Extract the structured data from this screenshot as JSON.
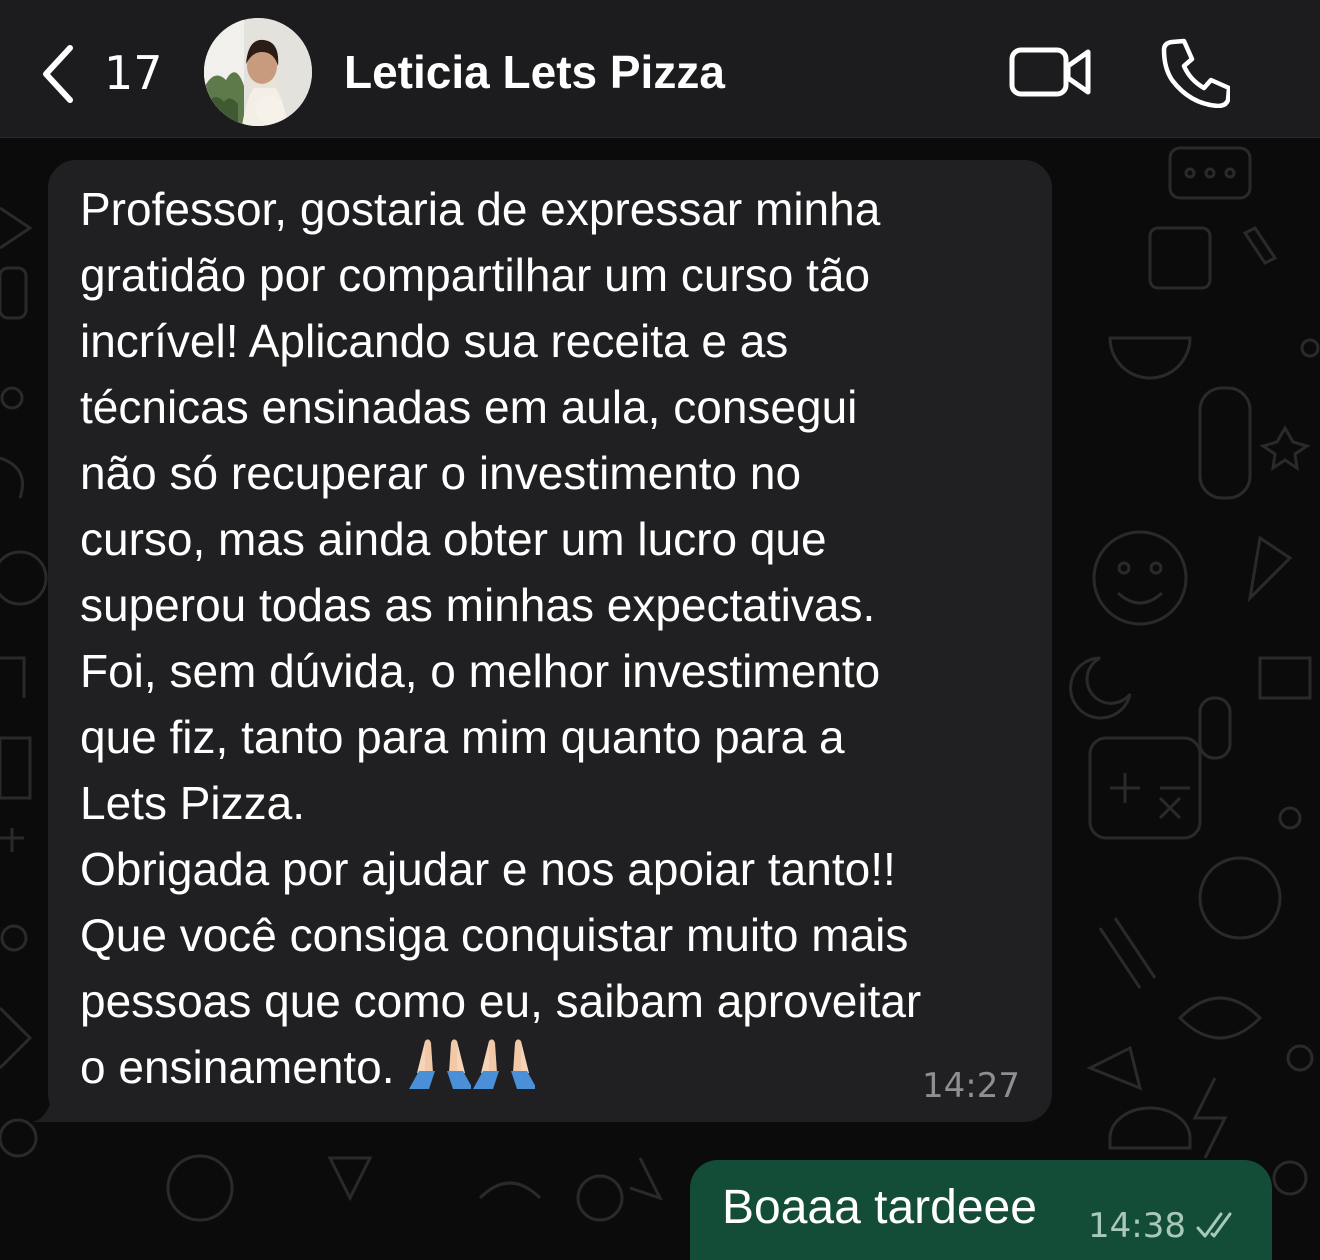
{
  "header": {
    "back_count": "17",
    "contact_name": "Leticia Lets Pizza",
    "back_icon": "chevron-left-icon",
    "video_icon": "video-camera-icon",
    "call_icon": "phone-icon"
  },
  "messages": [
    {
      "direction": "incoming",
      "text": "Professor, gostaria de expressar minha\ngratidão por compartilhar um curso tão\nincrível! Aplicando sua receita e as\ntécnicas ensinadas em aula, consegui\nnão só recuperar o investimento no\ncurso, mas ainda obter um lucro que\nsuperou todas as minhas expectativas.\nFoi, sem dúvida, o melhor investimento\nque fiz, tanto para mim quanto para a\nLets Pizza.\nObrigada por ajudar e nos apoiar tanto!!\nQue você consiga conquistar muito mais\npessoas que como eu, saibam aproveitar\no ensinamento.",
      "emoji": "🙏🏻🙏🏻",
      "time": "14:27"
    },
    {
      "direction": "outgoing",
      "text": "Boaaa tardeee",
      "time": "14:38",
      "status_icon": "double-check-icon"
    }
  ],
  "colors": {
    "background": "#0b0b0b",
    "header": "#1c1c1e",
    "incoming_bubble": "#202022",
    "outgoing_bubble": "#134d37",
    "timestamp": "#8e8e93"
  }
}
